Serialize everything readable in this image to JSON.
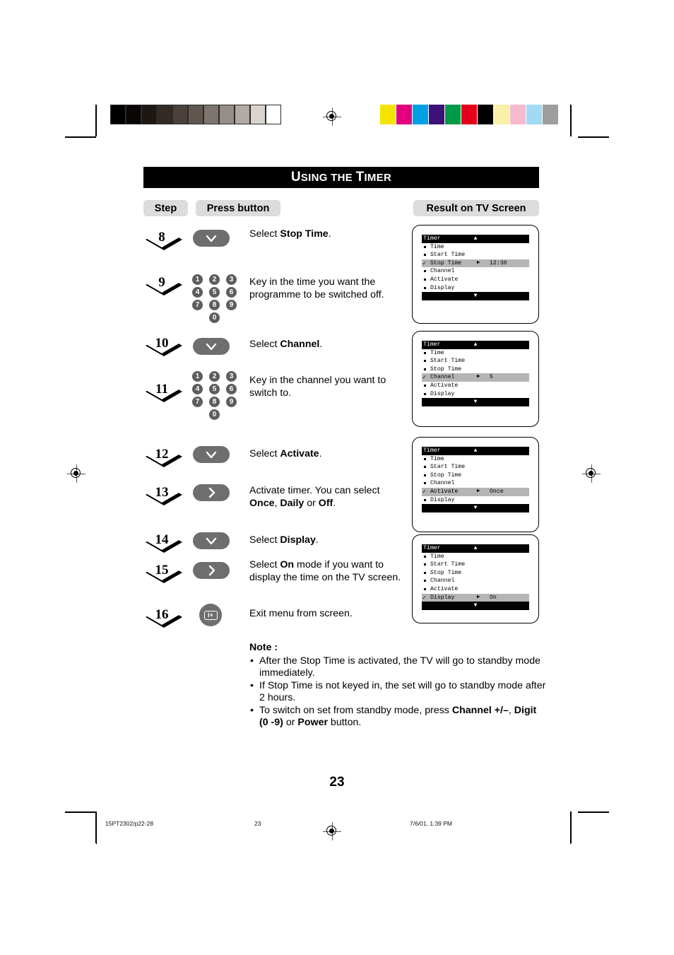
{
  "document": {
    "title": "Using the Timer",
    "title_parts": {
      "u": "U",
      "sing_the": "SING THE ",
      "t": "T",
      "imer": "IMER"
    },
    "page_number": "23"
  },
  "columns": {
    "step": "Step",
    "press_button": "Press button",
    "result": "Result on TV Screen"
  },
  "steps": [
    {
      "number": "8",
      "control": "chevron-down-button",
      "instruction_prefix": "Select ",
      "instruction_bold": "Stop Time",
      "instruction_suffix": "."
    },
    {
      "number": "9",
      "control": "numeric-keypad",
      "instruction_prefix": "Key in the time you want the programme to be switched off.",
      "instruction_bold": "",
      "instruction_suffix": ""
    },
    {
      "number": "10",
      "control": "chevron-down-button",
      "instruction_prefix": "Select ",
      "instruction_bold": "Channel",
      "instruction_suffix": "."
    },
    {
      "number": "11",
      "control": "numeric-keypad",
      "instruction_prefix": "Key in the channel you want to switch to.",
      "instruction_bold": "",
      "instruction_suffix": ""
    },
    {
      "number": "12",
      "control": "chevron-down-button",
      "instruction_prefix": "Select ",
      "instruction_bold": "Activate",
      "instruction_suffix": "."
    },
    {
      "number": "13",
      "control": "chevron-right-button",
      "instruction_prefix": "Activate timer. You can select ",
      "instruction_bold": "",
      "instruction_suffix": ""
    },
    {
      "number": "14",
      "control": "chevron-down-button",
      "instruction_prefix": "Select ",
      "instruction_bold": "Display",
      "instruction_suffix": "."
    },
    {
      "number": "15",
      "control": "chevron-right-button",
      "instruction_prefix": "Select ",
      "instruction_bold": "On",
      "instruction_suffix": " mode if you want to display the time on the TV screen."
    },
    {
      "number": "16",
      "control": "menu-info-button",
      "instruction_prefix": "Exit menu from screen.",
      "instruction_bold": "",
      "instruction_suffix": ""
    }
  ],
  "step13_options": {
    "once": "Once",
    "comma": ", ",
    "daily": "Daily",
    "or": " or ",
    "off": "Off",
    "period": "."
  },
  "keypad": {
    "row1": [
      "1",
      "2",
      "3"
    ],
    "row2": [
      "4",
      "5",
      "6"
    ],
    "row3": [
      "7",
      "8",
      "9"
    ],
    "row4": [
      "0"
    ]
  },
  "menu_button_label": "i+",
  "tv_screens": [
    {
      "title": "Timer",
      "rows": [
        {
          "label": "Time",
          "selected": false,
          "checked": false,
          "arrow": "",
          "value": ""
        },
        {
          "label": "Start Time",
          "selected": false,
          "checked": false,
          "arrow": "",
          "value": ""
        },
        {
          "label": "Stop Time",
          "selected": true,
          "checked": true,
          "arrow": "▶",
          "value": "12:30"
        },
        {
          "label": "Channel",
          "selected": false,
          "checked": false,
          "arrow": "",
          "value": ""
        },
        {
          "label": "Activate",
          "selected": false,
          "checked": false,
          "arrow": "",
          "value": ""
        },
        {
          "label": "Display",
          "selected": false,
          "checked": false,
          "arrow": "",
          "value": ""
        }
      ],
      "scroll_up": "▲",
      "scroll_down": "▼"
    },
    {
      "title": "Timer",
      "rows": [
        {
          "label": "Time",
          "selected": false,
          "checked": false,
          "arrow": "",
          "value": ""
        },
        {
          "label": "Start Time",
          "selected": false,
          "checked": false,
          "arrow": "",
          "value": ""
        },
        {
          "label": "Stop Time",
          "selected": false,
          "checked": false,
          "arrow": "",
          "value": ""
        },
        {
          "label": "Channel",
          "selected": true,
          "checked": true,
          "arrow": "▶",
          "value": "5"
        },
        {
          "label": "Activate",
          "selected": false,
          "checked": false,
          "arrow": "",
          "value": ""
        },
        {
          "label": "Display",
          "selected": false,
          "checked": false,
          "arrow": "",
          "value": ""
        }
      ],
      "scroll_up": "▲",
      "scroll_down": "▼"
    },
    {
      "title": "Timer",
      "rows": [
        {
          "label": "Time",
          "selected": false,
          "checked": false,
          "arrow": "",
          "value": ""
        },
        {
          "label": "Start Time",
          "selected": false,
          "checked": false,
          "arrow": "",
          "value": ""
        },
        {
          "label": "Stop Time",
          "selected": false,
          "checked": false,
          "arrow": "",
          "value": ""
        },
        {
          "label": "Channel",
          "selected": false,
          "checked": false,
          "arrow": "",
          "value": ""
        },
        {
          "label": "Activate",
          "selected": true,
          "checked": true,
          "arrow": "▶",
          "value": "Once"
        },
        {
          "label": "Display",
          "selected": false,
          "checked": false,
          "arrow": "",
          "value": ""
        }
      ],
      "scroll_up": "▲",
      "scroll_down": "▼"
    },
    {
      "title": "Timer",
      "rows": [
        {
          "label": "Time",
          "selected": false,
          "checked": false,
          "arrow": "",
          "value": ""
        },
        {
          "label": "Start Time",
          "selected": false,
          "checked": false,
          "arrow": "",
          "value": ""
        },
        {
          "label": "Stop Time",
          "selected": false,
          "checked": false,
          "arrow": "",
          "value": ""
        },
        {
          "label": "Channel",
          "selected": false,
          "checked": false,
          "arrow": "",
          "value": ""
        },
        {
          "label": "Activate",
          "selected": false,
          "checked": false,
          "arrow": "",
          "value": ""
        },
        {
          "label": "Display",
          "selected": true,
          "checked": true,
          "arrow": "▶",
          "value": "On"
        }
      ],
      "scroll_up": "▲",
      "scroll_down": "▼"
    }
  ],
  "note": {
    "heading": "Note",
    "heading_colon": " :",
    "bullet_char": "•",
    "items": [
      {
        "text": "After the Stop Time is activated, the TV will go to standby mode immediately."
      },
      {
        "text": "If Stop Time is not keyed in,  the set will go to standby mode after 2 hours."
      },
      {
        "text": "To switch on set from standby mode, press "
      }
    ],
    "item3_bold_1": "Channel +/–",
    "item3_mid": ", ",
    "item3_bold_2": "Digit (0 -9)",
    "item3_or": " or ",
    "item3_bold_3": "Power",
    "item3_tail": " button."
  },
  "footer": {
    "filename": "15PT2302/p22-28",
    "page": "23",
    "timestamp": "7/6/01, 1:39 PM"
  },
  "calibration": {
    "grayscale": [
      "#000000",
      "#090606",
      "#1d1713",
      "#332a24",
      "#4b403a",
      "#61564f",
      "#7d746d",
      "#968d87",
      "#b2aaa4",
      "#d9d4cd",
      "#ffffff"
    ],
    "colors": [
      "#f5e400",
      "#e2007f",
      "#00a0e3",
      "#3d1178",
      "#009a49",
      "#e2001a",
      "#000000",
      "#faf0a8",
      "#f7b9cd",
      "#a3d9f5",
      "#9d9d9d"
    ]
  }
}
